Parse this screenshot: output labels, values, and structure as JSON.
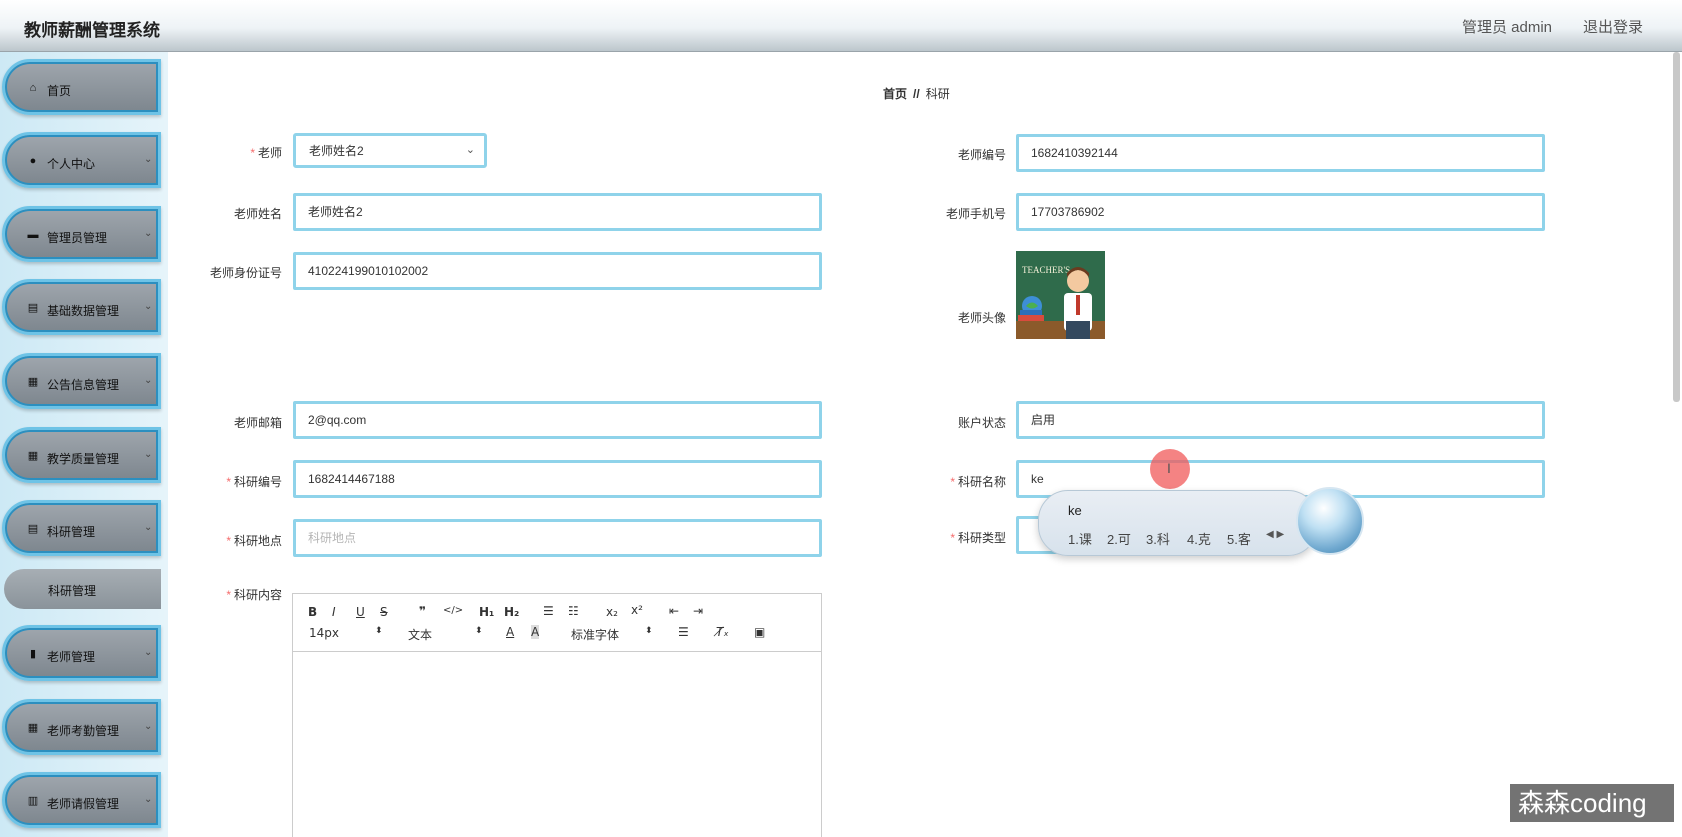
{
  "header": {
    "title": "教师薪酬管理系统",
    "user": "管理员 admin",
    "logout": "退出登录"
  },
  "sidebar": {
    "items": [
      {
        "label": "首页",
        "icon": "home-icon"
      },
      {
        "label": "个人中心",
        "icon": "user-icon"
      },
      {
        "label": "管理员管理",
        "icon": "briefcase-icon"
      },
      {
        "label": "基础数据管理",
        "icon": "clipboard-icon"
      },
      {
        "label": "公告信息管理",
        "icon": "grid-icon"
      },
      {
        "label": "教学质量管理",
        "icon": "grid-icon"
      },
      {
        "label": "科研管理",
        "icon": "clipboard-icon"
      },
      {
        "label": "老师管理",
        "icon": "book-icon"
      },
      {
        "label": "老师考勤管理",
        "icon": "grid-icon"
      },
      {
        "label": "老师请假管理",
        "icon": "bar-chart-icon"
      }
    ],
    "sub_item": "科研管理"
  },
  "breadcrumb": {
    "home": "首页",
    "separator": "//",
    "current": "科研"
  },
  "form": {
    "teacher_select": {
      "label": "老师",
      "value": "老师姓名2"
    },
    "teacher_no": {
      "label": "老师编号",
      "value": "1682410392144"
    },
    "teacher_name": {
      "label": "老师姓名",
      "value": "老师姓名2"
    },
    "teacher_phone": {
      "label": "老师手机号",
      "value": "17703786902"
    },
    "teacher_id": {
      "label": "老师身份证号",
      "value": "410224199010102002"
    },
    "teacher_avatar": {
      "label": "老师头像",
      "banner_text": "TEACHER'S"
    },
    "teacher_email": {
      "label": "老师邮箱",
      "value": "2@qq.com"
    },
    "account_status": {
      "label": "账户状态",
      "value": "启用"
    },
    "research_no": {
      "label": "科研编号",
      "value": "1682414467188"
    },
    "research_name": {
      "label": "科研名称",
      "value": "ke"
    },
    "research_place": {
      "label": "科研地点",
      "placeholder": "科研地点"
    },
    "research_type": {
      "label": "科研类型"
    },
    "research_content": {
      "label": "科研内容"
    }
  },
  "editor": {
    "font_size": "14px",
    "text_style": "文本",
    "font_family": "标准字体"
  },
  "ime": {
    "input": "ke",
    "candidates": [
      "1.课",
      "2.可",
      "3.科",
      "4.克",
      "5.客"
    ]
  },
  "watermark": "森森coding"
}
